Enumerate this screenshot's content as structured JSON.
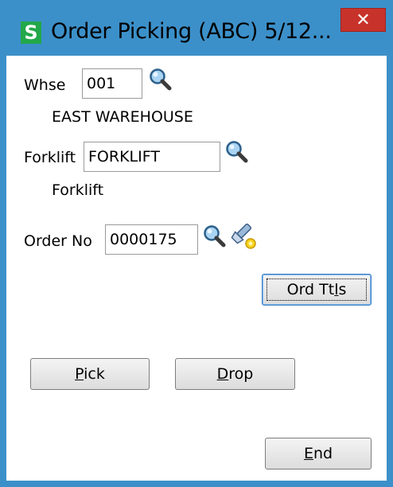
{
  "window": {
    "title": "Order Picking (ABC) 5/12...",
    "app_icon_letter": "S",
    "close_glyph": "✕",
    "colors": {
      "frame": "#3c90c9",
      "close": "#c7332a",
      "app_icon": "#22a84a"
    }
  },
  "warehouse": {
    "label": "Whse",
    "value": "001",
    "description": "EAST WAREHOUSE",
    "lookup_icon": "magnifier-icon"
  },
  "forklift": {
    "label": "Forklift",
    "value": "FORKLIFT",
    "description": "Forklift",
    "lookup_icon": "magnifier-icon"
  },
  "order": {
    "label": "Order No",
    "value": "0000175",
    "lookup_icon": "magnifier-icon",
    "lookup_alt_icon": "flashlight-icon"
  },
  "buttons": {
    "ord_ttls": {
      "before": "Ord Tt",
      "mnemonic": "l",
      "after": "s"
    },
    "pick": {
      "before": "",
      "mnemonic": "P",
      "after": "ick"
    },
    "drop": {
      "before": "",
      "mnemonic": "D",
      "after": "rop"
    },
    "end": {
      "before": "",
      "mnemonic": "E",
      "after": "nd"
    }
  }
}
